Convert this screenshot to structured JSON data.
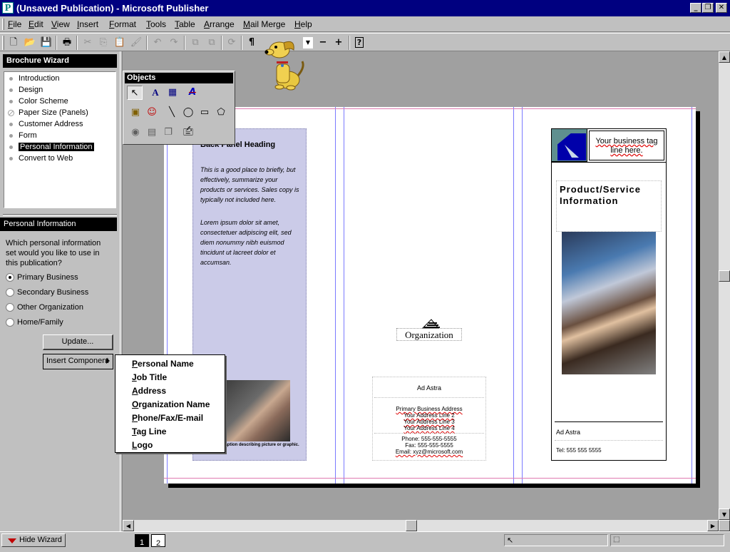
{
  "window": {
    "title": "(Unsaved Publication) - Microsoft Publisher",
    "app_icon": "P",
    "controls": [
      "_",
      "❐",
      "✕"
    ]
  },
  "menu": [
    "File",
    "Edit",
    "View",
    "Insert",
    "Format",
    "Tools",
    "Table",
    "Arrange",
    "Mail Merge",
    "Help"
  ],
  "toolbar": {
    "icons": [
      "new-icon",
      "open-icon",
      "save-icon",
      "print-icon",
      "cut-icon",
      "copy-icon",
      "paste-icon",
      "format-painter-icon",
      "undo-icon",
      "redo-icon",
      "bring-front-icon",
      "send-back-icon",
      "rotate-icon",
      "show-special-characters-icon",
      "zoom-dropdown-icon",
      "zoom-out-icon",
      "zoom-in-icon",
      "help-icon"
    ],
    "zoom_minus": "−",
    "zoom_plus": "+"
  },
  "wizard": {
    "title": "Brochure Wizard",
    "items": [
      "Introduction",
      "Design",
      "Color Scheme",
      "Paper Size (Panels)",
      "Customer Address",
      "Form",
      "Personal Information",
      "Convert to Web"
    ],
    "selected": "Personal Information",
    "section_title": "Personal Information",
    "question": "Which personal information set would you like to use in this publication?",
    "options": [
      "Primary Business",
      "Secondary Business",
      "Other Organization",
      "Home/Family"
    ],
    "selected_option": "Primary Business",
    "update_button": "Update...",
    "insert_component_button": "Insert Component"
  },
  "objects_toolbar": {
    "title": "Objects",
    "tools": [
      "pointer-icon",
      "text-frame-icon",
      "table-frame-icon",
      "wordart-frame-icon",
      "picture-frame-icon",
      "clip-gallery-icon",
      "line-icon",
      "oval-icon",
      "rectangle-icon",
      "custom-shapes-icon",
      "form-control-icon",
      "html-code-icon",
      "design-gallery-icon",
      "more-objects-icon"
    ]
  },
  "document": {
    "back_panel": {
      "heading": "Back Panel Heading",
      "para1": "This is a good place to briefly, but effectively, summarize your products or services. Sales copy is typically not included here.",
      "para2": "Lorem ipsum dolor sit amet, consectetuer adipiscing elit, sed diem nonummy nibh euismod tincidunt ut lacreet dolor et accumsan.",
      "caption": "Caption describing picture or graphic."
    },
    "middle_panel": {
      "organization": "Organization",
      "address_company": "Ad Astra",
      "address_lines": [
        "Primary Business Address",
        "Your Address Line 2",
        "Your Address Line 3",
        "Your Address Line 4"
      ],
      "phone": "Phone: 555-555-5555",
      "fax": "Fax: 555-555-5555",
      "email": "Email: xyz@microsoft.com"
    },
    "front_panel": {
      "tagline": "Your business tag line here.",
      "heading": "Product/Service Information",
      "company": "Ad Astra",
      "tel": "Tel: 555 555 5555"
    }
  },
  "popup_menu": [
    "Personal Name",
    "Job Title",
    "Address",
    "Organization Name",
    "Phone/Fax/E-mail",
    "Tag Line",
    "Logo"
  ],
  "status": {
    "hide_wizard": "Hide Wizard",
    "pages": [
      "1",
      "2"
    ],
    "current_page": "1"
  },
  "colors": {
    "title_bar": "#000080",
    "back_panel_fill": "#cbcbe8",
    "logo_blue": "#0000aa",
    "logo_teal": "#5f8f8f"
  }
}
